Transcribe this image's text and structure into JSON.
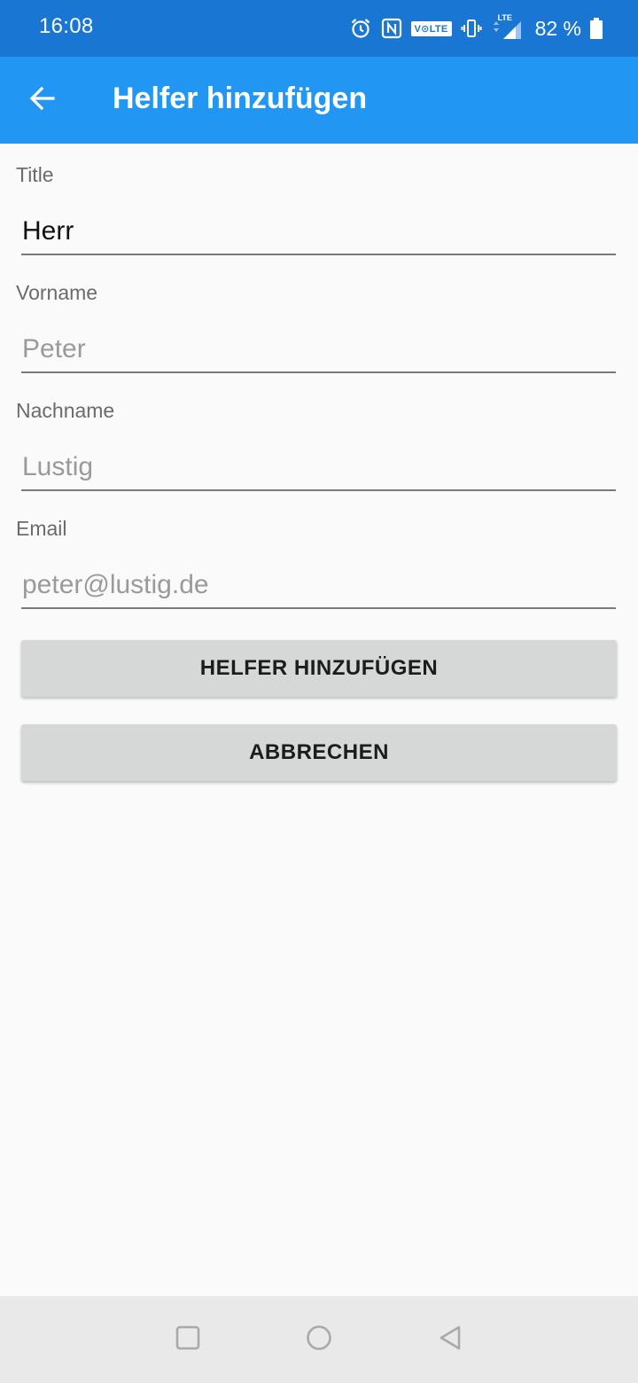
{
  "status_bar": {
    "time": "16:08",
    "volte": "V⊙LTE",
    "lte": "LTE",
    "battery": "82 %",
    "icons": [
      "alarm-icon",
      "nfc-icon",
      "volte-icon",
      "vibrate-icon",
      "signal-icon",
      "battery-icon"
    ]
  },
  "app_bar": {
    "title": "Helfer hinzufügen",
    "back_icon": "arrow-back-icon",
    "color": "#2196f3"
  },
  "form": {
    "title": {
      "label": "Title",
      "value": "Herr",
      "placeholder": ""
    },
    "vorname": {
      "label": "Vorname",
      "value": "",
      "placeholder": "Peter"
    },
    "nachname": {
      "label": "Nachname",
      "value": "",
      "placeholder": "Lustig"
    },
    "email": {
      "label": "Email",
      "value": "",
      "placeholder": "peter@lustig.de"
    }
  },
  "buttons": {
    "add": "HELFER HINZUFÜGEN",
    "cancel": "ABBRECHEN"
  },
  "nav_bar": {
    "icons": [
      "recents-icon",
      "home-icon",
      "back-icon"
    ]
  },
  "colors": {
    "status_bar": "#1976d2",
    "app_bar": "#2196f3",
    "background": "#fafafa",
    "button": "#d6d7d7"
  }
}
